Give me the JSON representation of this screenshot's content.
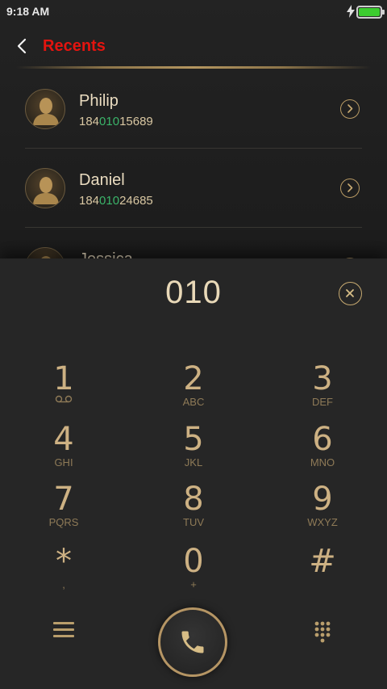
{
  "status_bar": {
    "time": "9:18 AM"
  },
  "header": {
    "title": "Recents"
  },
  "recents": [
    {
      "name": "Philip",
      "number_prefix": "184",
      "number_match": "010",
      "number_suffix": "15689"
    },
    {
      "name": "Daniel",
      "number_prefix": "184",
      "number_match": "010",
      "number_suffix": "24685"
    },
    {
      "name": "Jessica"
    }
  ],
  "dialer": {
    "display": "010",
    "keys": [
      {
        "digit": "1",
        "letters": "",
        "sub_icon": "voicemail-icon"
      },
      {
        "digit": "2",
        "letters": "ABC"
      },
      {
        "digit": "3",
        "letters": "DEF"
      },
      {
        "digit": "4",
        "letters": "GHI"
      },
      {
        "digit": "5",
        "letters": "JKL"
      },
      {
        "digit": "6",
        "letters": "MNO"
      },
      {
        "digit": "7",
        "letters": "PQRS"
      },
      {
        "digit": "8",
        "letters": "TUV"
      },
      {
        "digit": "9",
        "letters": "WXYZ"
      },
      {
        "digit": "*",
        "letters": ","
      },
      {
        "digit": "0",
        "letters": "+"
      },
      {
        "digit": "#",
        "letters": ""
      }
    ]
  },
  "colors": {
    "accent_gold": "#c6a970",
    "title_red": "#e3140f",
    "match_green": "#3bb46a",
    "battery_green": "#3ccc2f"
  },
  "icons": {
    "back": "chevron-left-icon",
    "detail": "chevron-right-circle-icon",
    "clear": "close-circle-icon",
    "menu": "menu-icon",
    "call": "phone-icon",
    "keypad": "keypad-icon"
  }
}
